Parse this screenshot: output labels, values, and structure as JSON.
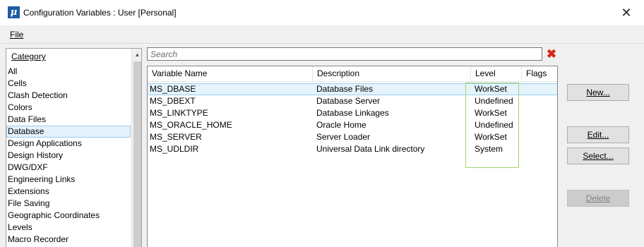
{
  "window": {
    "title": "Configuration Variables : User [Personal]",
    "app_icon_glyph": "μ",
    "close_glyph": "✕"
  },
  "menu": {
    "file_label": "File"
  },
  "category": {
    "header": "Category",
    "items": [
      {
        "label": "All"
      },
      {
        "label": "Cells"
      },
      {
        "label": "Clash Detection"
      },
      {
        "label": "Colors"
      },
      {
        "label": "Data Files"
      },
      {
        "label": "Database",
        "selected": true
      },
      {
        "label": "Design Applications"
      },
      {
        "label": "Design History"
      },
      {
        "label": "DWG/DXF"
      },
      {
        "label": "Engineering Links"
      },
      {
        "label": "Extensions"
      },
      {
        "label": "File Saving"
      },
      {
        "label": "Geographic Coordinates"
      },
      {
        "label": "Levels"
      },
      {
        "label": "Macro Recorder"
      }
    ]
  },
  "search": {
    "placeholder": "Search",
    "value": ""
  },
  "table": {
    "columns": [
      "Variable Name",
      "Description",
      "Level",
      "Flags"
    ],
    "rows": [
      {
        "name": "MS_DBASE",
        "description": "Database Files",
        "level": "WorkSet",
        "flags": "",
        "selected": true
      },
      {
        "name": "MS_DBEXT",
        "description": "Database Server",
        "level": "Undefined",
        "flags": ""
      },
      {
        "name": "MS_LINKTYPE",
        "description": "Database Linkages",
        "level": "WorkSet",
        "flags": ""
      },
      {
        "name": "MS_ORACLE_HOME",
        "description": "Oracle Home",
        "level": "Undefined",
        "flags": ""
      },
      {
        "name": "MS_SERVER",
        "description": "Server Loader",
        "level": "WorkSet",
        "flags": ""
      },
      {
        "name": "MS_UDLDIR",
        "description": "Universal Data Link directory",
        "level": "System",
        "flags": ""
      }
    ]
  },
  "buttons": {
    "new": "New...",
    "edit": "Edit...",
    "select": "Select...",
    "delete": "Delete"
  },
  "colors": {
    "selection_bg": "#e5f3fb",
    "level_highlight": "#a2d36b",
    "clear_icon": "#d42a1d"
  }
}
